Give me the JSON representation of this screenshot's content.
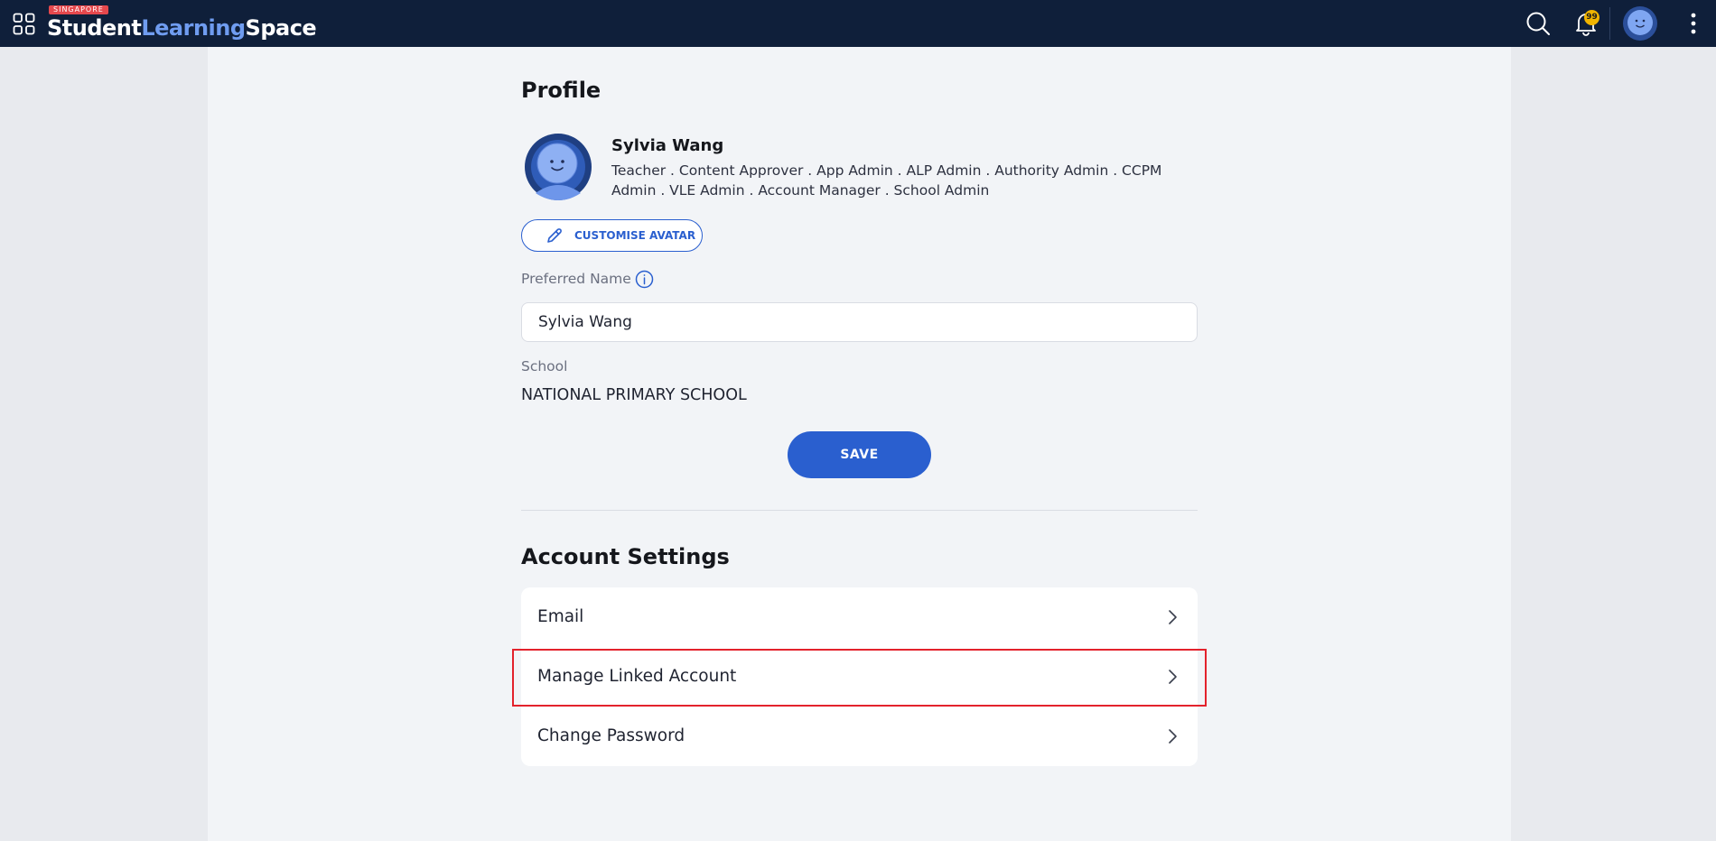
{
  "header": {
    "brand_tag": "SINGAPORE",
    "brand_word1": "Student",
    "brand_word2": "Learning",
    "brand_word3": "Space",
    "notification_count": "99",
    "icons": [
      "apps-grid-icon",
      "search-icon",
      "bell-icon",
      "avatar",
      "more-vertical-icon"
    ]
  },
  "profile": {
    "heading": "Profile",
    "name": "Sylvia Wang",
    "roles": "Teacher . Content Approver . App Admin . ALP Admin . Authority Admin . CCPM Admin . VLE Admin . Account Manager . School Admin",
    "customise_label": "CUSTOMISE AVATAR",
    "preferred_name_label": "Preferred Name",
    "preferred_name_value": "Sylvia Wang",
    "school_label": "School",
    "school_value": "NATIONAL PRIMARY SCHOOL",
    "save_label": "SAVE"
  },
  "account": {
    "heading": "Account Settings",
    "items": [
      {
        "label": "Email"
      },
      {
        "label": "Manage Linked Account"
      },
      {
        "label": "Change Password"
      }
    ]
  },
  "colors": {
    "topbar": "#0f1f3a",
    "brand_accent": "#6f9cf0",
    "primary": "#2a5fcf",
    "badge": "#f0b400",
    "highlight": "#e3222c"
  }
}
